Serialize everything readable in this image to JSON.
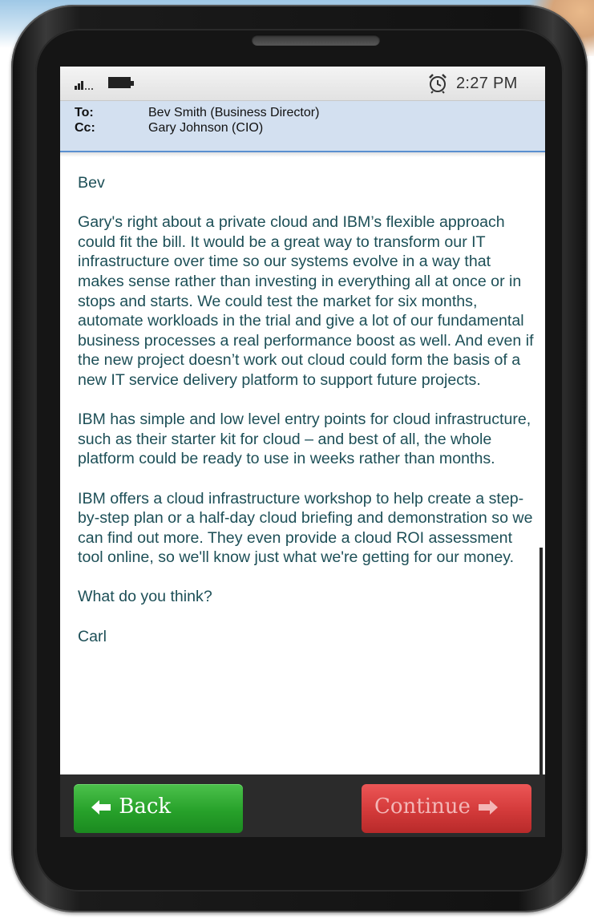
{
  "status_bar": {
    "time": "2:27 PM",
    "signal_icon": "signal-bars-icon",
    "battery_icon": "battery-icon",
    "alarm_icon": "alarm-clock-icon"
  },
  "email_header": {
    "to_label": "To:",
    "to_value": "Bev Smith (Business Director)",
    "cc_label": "Cc:",
    "cc_value": "Gary Johnson (CIO)"
  },
  "email_body": {
    "greeting": "Bev",
    "paragraph_1": "Gary's right about a private cloud and IBM’s flexible approach could fit the bill. It would be a great way to transform our IT infrastructure over time so our systems evolve in a way that makes sense rather than investing in everything all at once or in stops and starts. We could test the market for six months, automate workloads in the trial and give a lot of our fundamental business processes a real performance boost as well. And even if the new project doesn’t work out cloud could form the basis of a new IT service delivery platform to support future projects.",
    "paragraph_2": "IBM has simple and low level entry points for cloud infrastructure, such as their starter kit for cloud – and best of all, the whole platform could be ready to use in weeks rather than months.",
    "paragraph_3": "IBM offers a cloud infrastructure workshop to help create a step-by-step plan or a half-day cloud briefing and demonstration so we can find out more. They even provide a cloud ROI assessment tool online, so we'll know just what we're getting for our money.",
    "question": "What do you think?",
    "signature": "Carl"
  },
  "navigation": {
    "back_label": "Back",
    "continue_label": "Continue",
    "back_color": "#27a12a",
    "continue_color": "#d33a3a"
  },
  "colors": {
    "body_text": "#1d4f57",
    "header_background": "#d3e0f0",
    "header_border": "#5a8fd0"
  }
}
